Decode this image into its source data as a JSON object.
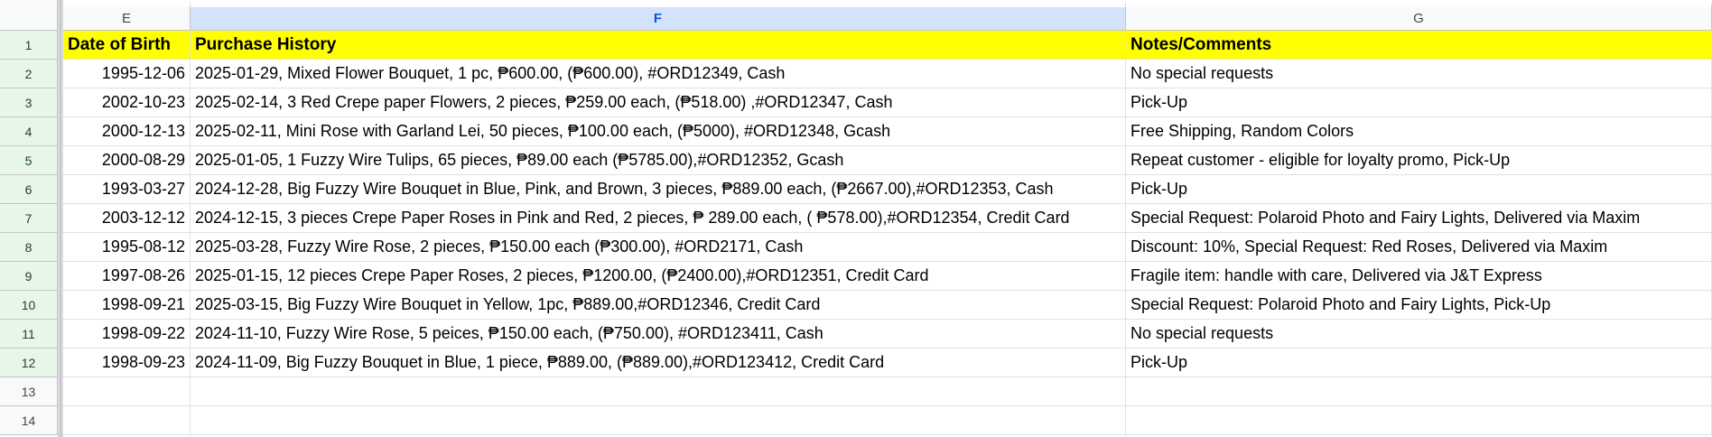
{
  "columns": [
    "E",
    "F",
    "G"
  ],
  "selected_column": "F",
  "header": {
    "date_of_birth": "Date of Birth",
    "purchase_history": "Purchase History",
    "notes": "Notes/Comments"
  },
  "row_numbers": [
    "1",
    "2",
    "3",
    "4",
    "5",
    "6",
    "7",
    "8",
    "9",
    "10",
    "11",
    "12",
    "13",
    "14"
  ],
  "rows": [
    {
      "dob": "1995-12-06",
      "purchase": "2025-01-29, Mixed Flower Bouquet, 1 pc, ₱600.00, (₱600.00), #ORD12349, Cash",
      "notes": "No special requests"
    },
    {
      "dob": "2002-10-23",
      "purchase": "2025-02-14, 3 Red Crepe paper Flowers, 2 pieces, ₱259.00 each, (₱518.00) ,#ORD12347, Cash",
      "notes": "Pick-Up"
    },
    {
      "dob": "2000-12-13",
      "purchase": "2025-02-11, Mini Rose with Garland Lei, 50 pieces, ₱100.00 each, (₱5000), #ORD12348, Gcash",
      "notes": "Free Shipping, Random Colors"
    },
    {
      "dob": "2000-08-29",
      "purchase": "2025-01-05, 1 Fuzzy Wire Tulips, 65 pieces, ₱89.00 each (₱5785.00),#ORD12352, Gcash",
      "notes": "Repeat customer - eligible for loyalty promo, Pick-Up"
    },
    {
      "dob": "1993-03-27",
      "purchase": "2024-12-28, Big Fuzzy Wire Bouquet in Blue, Pink, and Brown, 3 pieces, ₱889.00 each, (₱2667.00),#ORD12353, Cash",
      "notes": "Pick-Up"
    },
    {
      "dob": "2003-12-12",
      "purchase": "2024-12-15, 3 pieces Crepe Paper Roses in Pink and Red, 2 pieces,  ₱ 289.00 each, ( ₱578.00),#ORD12354, Credit Card",
      "notes": "Special Request: Polaroid Photo and Fairy Lights, Delivered via Maxim"
    },
    {
      "dob": "1995-08-12",
      "purchase": "2025-03-28, Fuzzy Wire Rose, 2 pieces, ₱150.00 each (₱300.00), #ORD2171, Cash",
      "notes": "Discount: 10%, Special Request: Red Roses, Delivered via Maxim"
    },
    {
      "dob": "1997-08-26",
      "purchase": "2025-01-15, 12 pieces Crepe Paper Roses, 2 pieces, ₱1200.00, (₱2400.00),#ORD12351, Credit Card",
      "notes": "Fragile item: handle with care, Delivered via J&T Express"
    },
    {
      "dob": "1998-09-21",
      "purchase": "2025-03-15, Big Fuzzy Wire Bouquet in Yellow, 1pc, ₱889.00,#ORD12346, Credit Card",
      "notes": "Special Request: Polaroid Photo and Fairy Lights, Pick-Up"
    },
    {
      "dob": "1998-09-22",
      "purchase": "2024-11-10, Fuzzy Wire Rose, 5 peices, ₱150.00 each, (₱750.00), #ORD123411, Cash",
      "notes": "No special requests"
    },
    {
      "dob": "1998-09-23",
      "purchase": "2024-11-09, Big Fuzzy Bouquet in Blue, 1 piece, ₱889.00, (₱889.00),#ORD123412, Credit Card",
      "notes": "Pick-Up"
    },
    {
      "dob": "",
      "purchase": "",
      "notes": ""
    },
    {
      "dob": "",
      "purchase": "",
      "notes": ""
    }
  ]
}
